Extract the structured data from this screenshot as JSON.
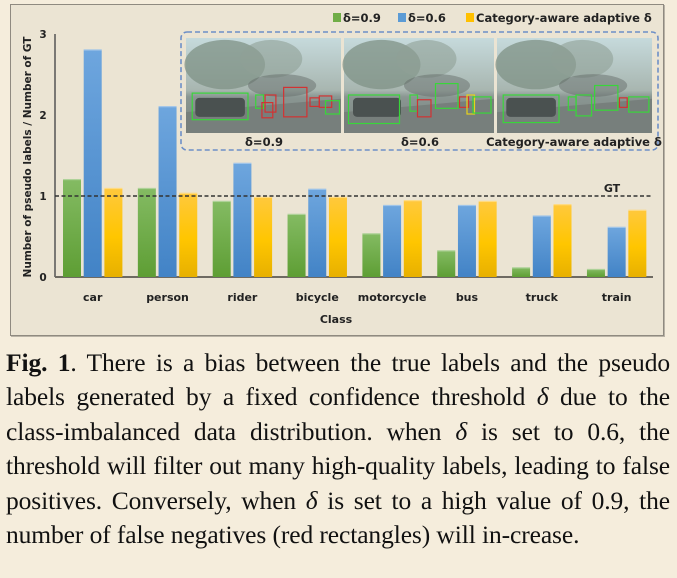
{
  "chart_data": {
    "type": "bar",
    "title": "",
    "xlabel": "Class",
    "ylabel": "Number of pseudo labels / Number of GT",
    "ylim": [
      0,
      3
    ],
    "yticks": [
      "0",
      "1",
      "2",
      "3"
    ],
    "grid": false,
    "legend_position": "top-right",
    "categories": [
      "car",
      "person",
      "rider",
      "bicycle",
      "motorcycle",
      "bus",
      "truck",
      "train"
    ],
    "series": [
      {
        "name": "δ=0.9",
        "color": "#70ad47",
        "values": [
          1.21,
          1.1,
          0.94,
          0.78,
          0.54,
          0.33,
          0.12,
          0.1
        ]
      },
      {
        "name": "δ=0.6",
        "color": "#5b9bd5",
        "values": [
          2.81,
          2.11,
          1.41,
          1.09,
          0.89,
          0.89,
          0.76,
          0.62
        ]
      },
      {
        "name": "Category-aware adaptive δ",
        "color": "#ffc000",
        "values": [
          1.1,
          1.04,
          0.99,
          0.99,
          0.95,
          0.94,
          0.9,
          0.83
        ]
      }
    ],
    "reference_line": {
      "label": "GT",
      "value": 1.0,
      "style": "dashed"
    },
    "inset_panels": [
      {
        "label": "δ=0.9",
        "description": "foggy street scene; several missed objects marked with red rectangles"
      },
      {
        "label": "δ=0.6",
        "description": "foggy street scene; many detections (green), a few red/yellow boxes"
      },
      {
        "label": "Category-aware adaptive δ",
        "description": "foggy street scene; mostly green detections, one red box"
      }
    ]
  },
  "caption": {
    "fig_label": "Fig. 1",
    "segments": [
      ". There is a bias between the true labels and the pseudo labels generated by a fixed confidence threshold ",
      "δ",
      " due to the class-imbalanced data distribution.  when ",
      "δ",
      " is set to 0.6, the threshold will filter out many high-quality labels, leading to false positives.  Conversely, when ",
      "δ",
      " is set to a high value of 0.9, the number of false negatives (red rectangles) will in-crease."
    ]
  }
}
